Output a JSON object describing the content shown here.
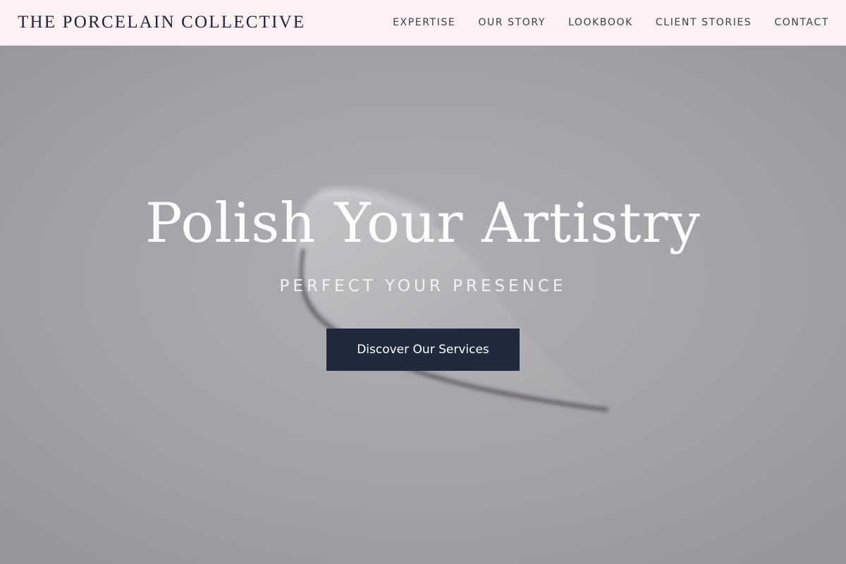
{
  "header": {
    "brand": "THE PORCELAIN COLLECTIVE",
    "nav": [
      {
        "label": "EXPERTISE"
      },
      {
        "label": "OUR STORY"
      },
      {
        "label": "LOOKBOOK"
      },
      {
        "label": "CLIENT STORIES"
      },
      {
        "label": "CONTACT"
      }
    ]
  },
  "hero": {
    "title": "Polish Your Artistry",
    "subtitle": "PERFECT YOUR PRESENCE",
    "cta_label": "Discover Our Services",
    "background_image": "cosmetic-cream-swatch"
  },
  "colors": {
    "nav_background": "#fdf1f4",
    "brand_text": "#1e2436",
    "cta_background": "#1f2a3d",
    "hero_overlay": "#a4a2a6"
  }
}
